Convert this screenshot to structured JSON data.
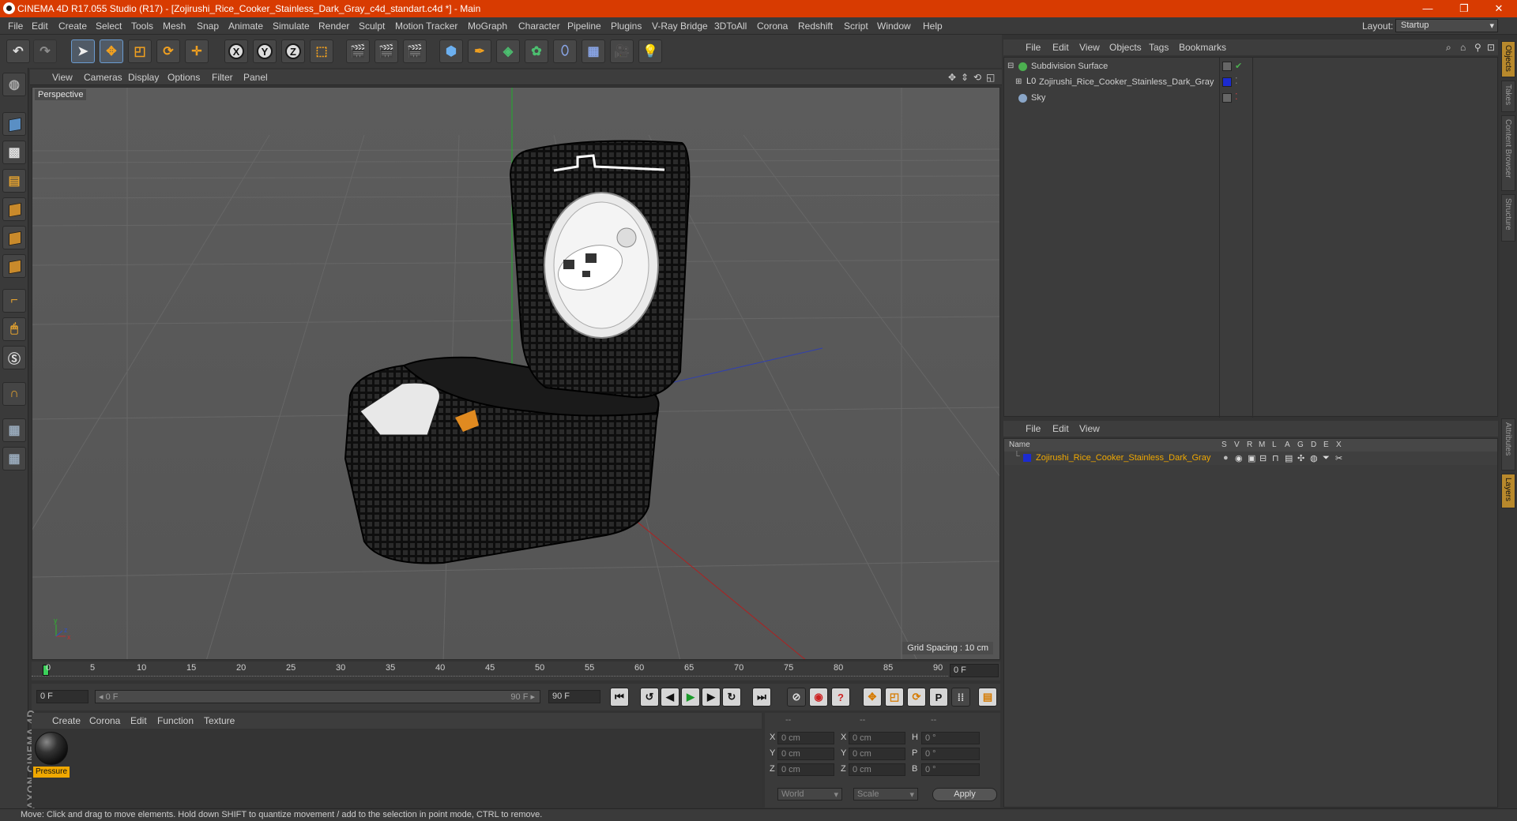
{
  "titlebar": {
    "title": "CINEMA 4D R17.055 Studio (R17) - [Zojirushi_Rice_Cooker_Stainless_Dark_Gray_c4d_standart.c4d *] - Main",
    "minimize": "—",
    "restore": "❐",
    "close": "✕"
  },
  "menu": [
    "File",
    "Edit",
    "Create",
    "Select",
    "Tools",
    "Mesh",
    "Snap",
    "Animate",
    "Simulate",
    "Render",
    "Sculpt",
    "Motion Tracker",
    "MoGraph",
    "Character",
    "Pipeline",
    "Plugins",
    "V-Ray Bridge",
    "3DToAll",
    "Corona",
    "Redshift",
    "Script",
    "Window",
    "Help"
  ],
  "layout": {
    "label": "Layout:",
    "value": "Startup"
  },
  "viewport": {
    "menu": [
      "View",
      "Cameras",
      "Display",
      "Options",
      "Filter",
      "Panel"
    ],
    "label": "Perspective",
    "grid_spacing": "Grid Spacing : 10 cm"
  },
  "timeline": {
    "ticks": [
      "0",
      "5",
      "10",
      "15",
      "20",
      "25",
      "30",
      "35",
      "40",
      "45",
      "50",
      "55",
      "60",
      "65",
      "70",
      "75",
      "80",
      "85",
      "90"
    ],
    "current_frame": "0 F",
    "start_frame": "0 F",
    "range_start": "◂ 0 F",
    "range_end": "90 F ▸",
    "end_frame": "90 F"
  },
  "materials": {
    "menu": [
      "Create",
      "Corona",
      "Edit",
      "Function",
      "Texture"
    ],
    "items": [
      {
        "name": "Pressure"
      }
    ]
  },
  "coordinates": {
    "header": [
      "--",
      "--",
      "--"
    ],
    "rows": [
      {
        "axis": "X",
        "pos": "0 cm",
        "axis2": "X",
        "size": "0 cm",
        "axis3": "H",
        "rot": "0 °"
      },
      {
        "axis": "Y",
        "pos": "0 cm",
        "axis2": "Y",
        "size": "0 cm",
        "axis3": "P",
        "rot": "0 °"
      },
      {
        "axis": "Z",
        "pos": "0 cm",
        "axis2": "Z",
        "size": "0 cm",
        "axis3": "B",
        "rot": "0 °"
      }
    ],
    "mode": "World",
    "scale": "Scale",
    "apply": "Apply"
  },
  "objects": {
    "menu": [
      "File",
      "Edit",
      "View",
      "Objects",
      "Tags",
      "Bookmarks"
    ],
    "rows": [
      {
        "name": "Subdivision Surface",
        "color": "#4caf50"
      },
      {
        "name": "Zojirushi_Rice_Cooker_Stainless_Dark_Gray",
        "color": "#1c2bd0"
      },
      {
        "name": "Sky",
        "color": "#8aa6c8"
      }
    ]
  },
  "layers": {
    "menu": [
      "File",
      "Edit",
      "View"
    ],
    "columns": [
      "Name",
      "S",
      "V",
      "R",
      "M",
      "L",
      "A",
      "G",
      "D",
      "E",
      "X"
    ],
    "rows": [
      {
        "name": "Zojirushi_Rice_Cooker_Stainless_Dark_Gray",
        "color": "#1c2bd0"
      }
    ]
  },
  "right_tabs": [
    "Objects",
    "Takes",
    "Content Browser",
    "Structure",
    "Attributes",
    "Layers"
  ],
  "logo": "MAXON CINEMA 4D",
  "status": "Move: Click and drag to move elements. Hold down SHIFT to quantize movement / add to the selection in point mode, CTRL to remove."
}
